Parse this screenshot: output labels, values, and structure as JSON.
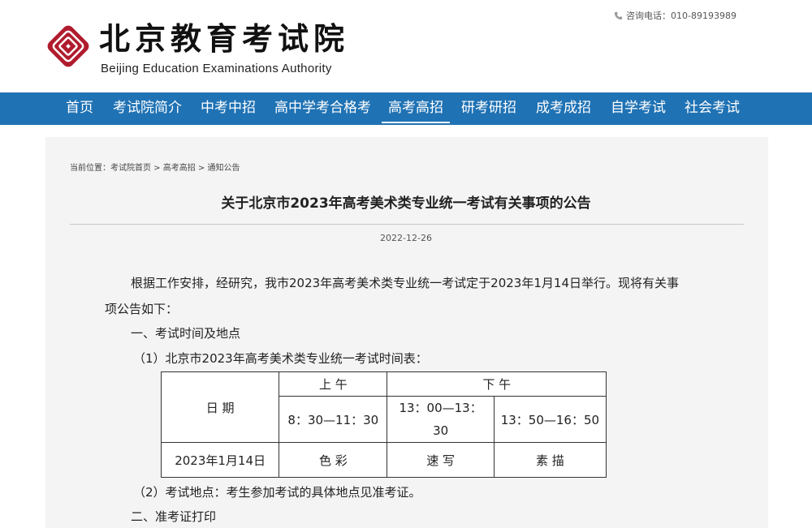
{
  "header": {
    "logo_cn": "北京教育考试院",
    "logo_en": "Beijing Education Examinations Authority",
    "contact": "咨询电话：010-89193989",
    "brand_color": "#b01c2e"
  },
  "nav": {
    "color": "#1f72b4",
    "items": [
      {
        "label": "首页"
      },
      {
        "label": "考试院简介"
      },
      {
        "label": "中考中招"
      },
      {
        "label": "高中学考合格考"
      },
      {
        "label": "高考高招"
      },
      {
        "label": "研考研招"
      },
      {
        "label": "成考成招"
      },
      {
        "label": "自学考试"
      },
      {
        "label": "社会考试"
      }
    ],
    "active": "高考高招"
  },
  "breadcrumb": {
    "prefix": "当前位置：",
    "items": [
      "考试院首页",
      "高考高招",
      "通知公告"
    ],
    "separator": " > "
  },
  "article": {
    "title": "关于北京市2023年高考美术类专业统一考试有关事项的公告",
    "date": "2022-12-26",
    "intro_line1": "根据工作安排，经研究，我市2023年高考美术类专业统一考试定于2023年1月14日举行。现将有关事",
    "intro_line2": "项公告如下：",
    "section1": "一、考试时间及地点",
    "item1": "（1）北京市2023年高考美术类专业统一考试时间表：",
    "item2": "（2）考试地点：考生参加考试的具体地点见准考证。",
    "section2": "二、准考证打印"
  },
  "schedule": {
    "date_header": "日  期",
    "morning_header": "上  午",
    "afternoon_header": "下    午",
    "morning_time": "8：30—11：30",
    "afternoon_time1_line1": "13：00—13：",
    "afternoon_time1_line2": "30",
    "afternoon_time2": "13：50—16：50",
    "row_date": "2023年1月14日",
    "subject_morning": "色 彩",
    "subject_afternoon1": "速 写",
    "subject_afternoon2": "素 描"
  }
}
